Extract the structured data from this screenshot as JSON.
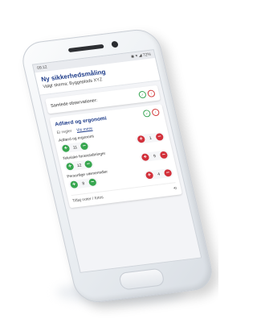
{
  "status": {
    "time": "09:12",
    "icons": "◉ ▾ ◢ 72%"
  },
  "header": {
    "title": "Ny sikkerhedsmåling",
    "site": "Valgt skema: Byggeplads XYZ"
  },
  "observations_card": {
    "label": "Samlede observationer:"
  },
  "behavior": {
    "title": "Adfærd og ergonomi",
    "tab_rules": "Ei regler",
    "tab_view": "Vis mere",
    "metrics": [
      {
        "label": "Adfærd og ergonomi",
        "safe_count": "11",
        "unsafe_count": "1"
      },
      {
        "label": "Tekniske foranstaltninger",
        "safe_count": "12",
        "unsafe_count": "9"
      },
      {
        "label": "Personlige værnemidler",
        "safe_count": "8",
        "unsafe_count": "4"
      }
    ],
    "notes_label": "Tilføj noter / fotos"
  },
  "icons": {
    "plus": "+",
    "minus": "−",
    "history": "⟲"
  },
  "colors": {
    "brand": "#1f3d8a",
    "safe": "#37a64f",
    "unsafe": "#d2303a"
  }
}
